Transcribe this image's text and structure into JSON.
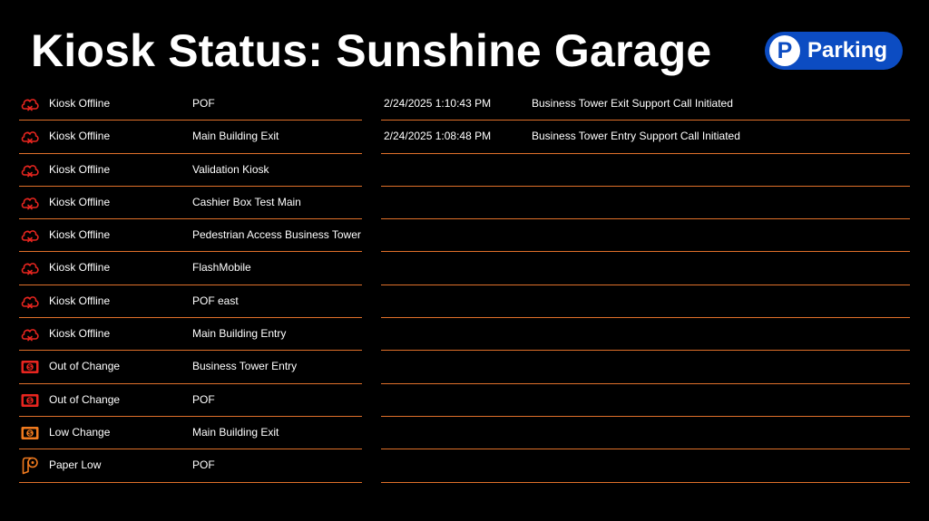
{
  "header": {
    "title": "Kiosk Status: Sunshine Garage",
    "badge": {
      "icon_letter": "P",
      "label": "Parking",
      "color": "#0c4cc2"
    }
  },
  "kiosk_statuses": [
    {
      "icon": "cloud-offline-icon",
      "color": "#e8251f",
      "status": "Kiosk Offline",
      "location": "POF"
    },
    {
      "icon": "cloud-offline-icon",
      "color": "#e8251f",
      "status": "Kiosk Offline",
      "location": "Main Building Exit"
    },
    {
      "icon": "cloud-offline-icon",
      "color": "#e8251f",
      "status": "Kiosk Offline",
      "location": "Validation Kiosk"
    },
    {
      "icon": "cloud-offline-icon",
      "color": "#e8251f",
      "status": "Kiosk Offline",
      "location": "Cashier Box Test Main"
    },
    {
      "icon": "cloud-offline-icon",
      "color": "#e8251f",
      "status": "Kiosk Offline",
      "location": "Pedestrian Access Business Tower"
    },
    {
      "icon": "cloud-offline-icon",
      "color": "#e8251f",
      "status": "Kiosk Offline",
      "location": "FlashMobile"
    },
    {
      "icon": "cloud-offline-icon",
      "color": "#e8251f",
      "status": "Kiosk Offline",
      "location": "POF east"
    },
    {
      "icon": "cloud-offline-icon",
      "color": "#e8251f",
      "status": "Kiosk Offline",
      "location": "Main Building Entry"
    },
    {
      "icon": "cash-icon",
      "color": "#e8251f",
      "status": "Out of Change",
      "location": "Business Tower Entry"
    },
    {
      "icon": "cash-icon",
      "color": "#e8251f",
      "status": "Out of Change",
      "location": "POF"
    },
    {
      "icon": "cash-icon",
      "color": "#f07a1e",
      "status": "Low Change",
      "location": "Main Building Exit"
    },
    {
      "icon": "paper-roll-icon",
      "color": "#f07a1e",
      "status": "Paper Low",
      "location": "POF"
    }
  ],
  "support_calls": [
    {
      "time": "2/24/2025 1:10:43 PM",
      "message": "Business Tower Exit Support Call Initiated"
    },
    {
      "time": "2/24/2025 1:08:48 PM",
      "message": "Business Tower Entry Support Call Initiated"
    },
    {
      "time": "",
      "message": ""
    },
    {
      "time": "",
      "message": ""
    },
    {
      "time": "",
      "message": ""
    },
    {
      "time": "",
      "message": ""
    },
    {
      "time": "",
      "message": ""
    },
    {
      "time": "",
      "message": ""
    },
    {
      "time": "",
      "message": ""
    },
    {
      "time": "",
      "message": ""
    },
    {
      "time": "",
      "message": ""
    },
    {
      "time": "",
      "message": ""
    }
  ],
  "colors": {
    "divider": "#e0702a",
    "offline": "#e8251f",
    "warning": "#f07a1e"
  }
}
